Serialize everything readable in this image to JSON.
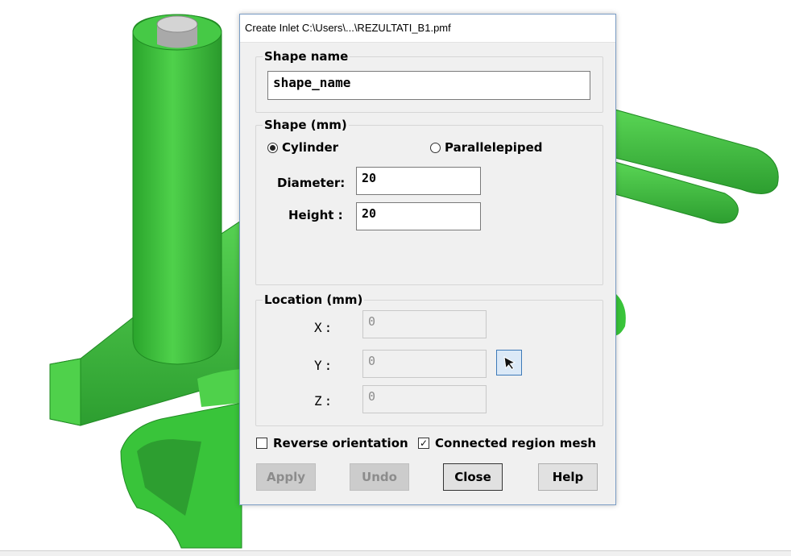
{
  "dialog": {
    "title": "Create Inlet  C:\\Users\\...\\REZULTATI_B1.pmf",
    "shape_name": {
      "legend": "Shape name",
      "value": "shape_name"
    },
    "shape": {
      "legend": "Shape (mm)",
      "options": [
        {
          "label": "Cylinder",
          "selected": true
        },
        {
          "label": "Parallelepiped",
          "selected": false
        }
      ],
      "diameter_label": "Diameter:",
      "diameter_value": "20",
      "height_label": "Height :",
      "height_value": "20"
    },
    "location": {
      "legend": "Location (mm)",
      "x_label": "X:",
      "x_value": "0",
      "y_label": "Y:",
      "y_value": "0",
      "z_label": "Z:",
      "z_value": "0",
      "pick_icon": "arrow-cursor-icon"
    },
    "options": {
      "reverse_label": "Reverse orientation",
      "reverse_checked": false,
      "connected_label": "Connected region mesh",
      "connected_checked": true
    },
    "buttons": {
      "apply": "Apply",
      "undo": "Undo",
      "close": "Close",
      "help": "Help"
    }
  },
  "colors": {
    "model_green": "#39c43a",
    "model_dark": "#1f8a22",
    "cap_grey": "#c0c0c0"
  }
}
